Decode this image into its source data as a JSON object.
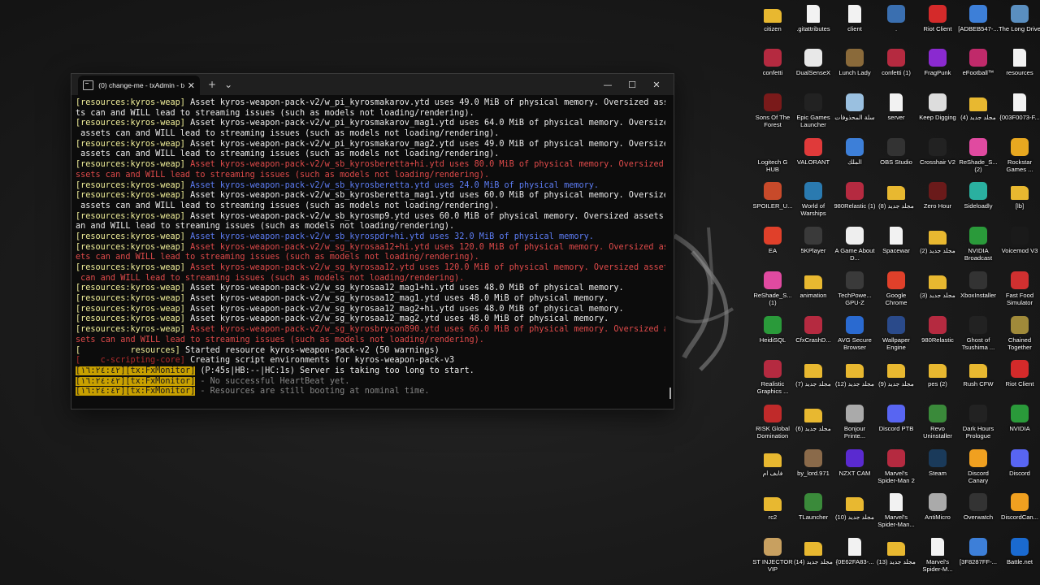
{
  "window": {
    "tab_title": "(0) change-me - txAdmin - txA",
    "tab_close": "✕",
    "new_tab": "+",
    "dropdown": "⌄",
    "minimize": "—",
    "maximize": "☐",
    "close": "✕"
  },
  "console_lines": [
    [
      [
        "c-yellow",
        "[resources:kyros-weap]"
      ],
      [
        "c-white",
        " Asset kyros-weapon-pack-v2/w_pi_kyrosmakarov.ytd uses 49.0 MiB of physical memory. Oversized asse"
      ]
    ],
    [
      [
        "c-white",
        "ts can and WILL lead to streaming issues (such as models not loading/rendering)."
      ]
    ],
    [
      [
        "c-yellow",
        "[resources:kyros-weap]"
      ],
      [
        "c-white",
        " Asset kyros-weapon-pack-v2/w_pi_kyrosmakarov_mag1.ytd uses 64.0 MiB of physical memory. Oversized"
      ]
    ],
    [
      [
        "c-white",
        " assets can and WILL lead to streaming issues (such as models not loading/rendering)."
      ]
    ],
    [
      [
        "c-yellow",
        "[resources:kyros-weap]"
      ],
      [
        "c-white",
        " Asset kyros-weapon-pack-v2/w_pi_kyrosmakarov_mag2.ytd uses 49.0 MiB of physical memory. Oversized"
      ]
    ],
    [
      [
        "c-white",
        " assets can and WILL lead to streaming issues (such as models not loading/rendering)."
      ]
    ],
    [
      [
        "c-yellow",
        "[resources:kyros-weap]"
      ],
      [
        "c-red",
        " Asset kyros-weapon-pack-v2/w_sb_kyrosberetta+hi.ytd uses 80.0 MiB of physical memory. Oversized a"
      ]
    ],
    [
      [
        "c-red",
        "ssets can and WILL lead to streaming issues (such as models not loading/rendering)."
      ]
    ],
    [
      [
        "c-yellow",
        "[resources:kyros-weap]"
      ],
      [
        "c-blue",
        " Asset kyros-weapon-pack-v2/w_sb_kyrosberetta.ytd uses 24.0 MiB of physical memory."
      ]
    ],
    [
      [
        "c-yellow",
        "[resources:kyros-weap]"
      ],
      [
        "c-white",
        " Asset kyros-weapon-pack-v2/w_sb_kyrosberetta_mag1.ytd uses 60.0 MiB of physical memory. Oversized"
      ]
    ],
    [
      [
        "c-white",
        " assets can and WILL lead to streaming issues (such as models not loading/rendering)."
      ]
    ],
    [
      [
        "c-yellow",
        "[resources:kyros-weap]"
      ],
      [
        "c-white",
        " Asset kyros-weapon-pack-v2/w_sb_kyrosmp9.ytd uses 60.0 MiB of physical memory. Oversized assets c"
      ]
    ],
    [
      [
        "c-white",
        "an and WILL lead to streaming issues (such as models not loading/rendering)."
      ]
    ],
    [
      [
        "c-yellow",
        "[resources:kyros-weap]"
      ],
      [
        "c-blue",
        " Asset kyros-weapon-pack-v2/w_sb_kyrospdr+hi.ytd uses 32.0 MiB of physical memory."
      ]
    ],
    [
      [
        "c-yellow",
        "[resources:kyros-weap]"
      ],
      [
        "c-red",
        " Asset kyros-weapon-pack-v2/w_sg_kyrosaa12+hi.ytd uses 120.0 MiB of physical memory. Oversized ass"
      ]
    ],
    [
      [
        "c-red",
        "ets can and WILL lead to streaming issues (such as models not loading/rendering)."
      ]
    ],
    [
      [
        "c-yellow",
        "[resources:kyros-weap]"
      ],
      [
        "c-red",
        " Asset kyros-weapon-pack-v2/w_sg_kyrosaa12.ytd uses 120.0 MiB of physical memory. Oversized assets"
      ]
    ],
    [
      [
        "c-red",
        " can and WILL lead to streaming issues (such as models not loading/rendering)."
      ]
    ],
    [
      [
        "c-yellow",
        "[resources:kyros-weap]"
      ],
      [
        "c-white",
        " Asset kyros-weapon-pack-v2/w_sg_kyrosaa12_mag1+hi.ytd uses 48.0 MiB of physical memory."
      ]
    ],
    [
      [
        "c-yellow",
        "[resources:kyros-weap]"
      ],
      [
        "c-white",
        " Asset kyros-weapon-pack-v2/w_sg_kyrosaa12_mag1.ytd uses 48.0 MiB of physical memory."
      ]
    ],
    [
      [
        "c-yellow",
        "[resources:kyros-weap]"
      ],
      [
        "c-white",
        " Asset kyros-weapon-pack-v2/w_sg_kyrosaa12_mag2+hi.ytd uses 48.0 MiB of physical memory."
      ]
    ],
    [
      [
        "c-yellow",
        "[resources:kyros-weap]"
      ],
      [
        "c-white",
        " Asset kyros-weapon-pack-v2/w_sg_kyrosaa12_mag2.ytd uses 48.0 MiB of physical memory."
      ]
    ],
    [
      [
        "c-yellow",
        "[resources:kyros-weap]"
      ],
      [
        "c-red",
        " Asset kyros-weapon-pack-v2/w_sg_kyrosbryson890.ytd uses 66.0 MiB of physical memory. Oversized as"
      ]
    ],
    [
      [
        "c-red",
        "sets can and WILL lead to streaming issues (such as models not loading/rendering)."
      ]
    ],
    [
      [
        "c-yellow",
        "[          resources]"
      ],
      [
        "c-white",
        " Started resource kyros-weapon-pack-v2 (50 warnings)"
      ]
    ],
    [
      [
        "c-darkred",
        "[    c-scripting-core]"
      ],
      [
        "c-white",
        " Creating script environments for kyros-weapon-pack-v3"
      ]
    ],
    [
      [
        "c-tag",
        "[١٦:٢٤:٤٢][tx:FxMonitor]"
      ],
      [
        "c-white",
        " (P:45s|HB:--|HC:1s) Server is taking too long to start."
      ]
    ],
    [
      [
        "c-tag",
        "[١٦:٢٤:٤٢][tx:FxMonitor]"
      ],
      [
        "c-grey",
        " - No successful HeartBeat yet."
      ]
    ],
    [
      [
        "c-tag",
        "[١٦:٢٤:٤٢][tx:FxMonitor]"
      ],
      [
        "c-grey",
        " - Resources are still booting at nominal time."
      ]
    ]
  ],
  "desktop_icons": [
    {
      "label": "citizen",
      "color": "#e8b830",
      "kind": "folder"
    },
    {
      "label": ".gitattributes",
      "color": "#f2f2f2",
      "kind": "file"
    },
    {
      "label": "client",
      "color": "#f2f2f2",
      "kind": "file"
    },
    {
      "label": ".",
      "color": "#3a6fb0",
      "kind": "app"
    },
    {
      "label": "Riot Client",
      "color": "#d42a2a",
      "kind": "app"
    },
    {
      "label": "[ADBEB547-...",
      "color": "#3d7fd8",
      "kind": "app"
    },
    {
      "label": "The Long Drive",
      "color": "#5a8fc0",
      "kind": "app"
    },
    {
      "label": "confetti",
      "color": "#b52a40",
      "kind": "app"
    },
    {
      "label": "DualSenseX",
      "color": "#e8e8e8",
      "kind": "app"
    },
    {
      "label": "Lunch Lady",
      "color": "#8a6a3a",
      "kind": "app"
    },
    {
      "label": "confetti (1)",
      "color": "#b52a40",
      "kind": "app"
    },
    {
      "label": "FragPunk",
      "color": "#8a2ad0",
      "kind": "app"
    },
    {
      "label": "eFootball™",
      "color": "#c02a6a",
      "kind": "app"
    },
    {
      "label": "resources",
      "color": "#f2f2f2",
      "kind": "file"
    },
    {
      "label": "Sons Of The Forest",
      "color": "#7a1a1a",
      "kind": "app"
    },
    {
      "label": "Epic Games Launcher",
      "color": "#222222",
      "kind": "app"
    },
    {
      "label": "سلة المحذوفات",
      "color": "#9ac0e0",
      "kind": "app"
    },
    {
      "label": "server",
      "color": "#f2f2f2",
      "kind": "file"
    },
    {
      "label": "Keep Digging",
      "color": "#dddddd",
      "kind": "app"
    },
    {
      "label": "مجلد جديد (4)",
      "color": "#e8b830",
      "kind": "folder"
    },
    {
      "label": "{003F0073-F...",
      "color": "#f2f2f2",
      "kind": "file"
    },
    {
      "label": "Logitech G HUB",
      "color": "#1a1a1a",
      "kind": "app"
    },
    {
      "label": "VALORANT",
      "color": "#e03a3a",
      "kind": "app"
    },
    {
      "label": "الملك",
      "color": "#3d7fd8",
      "kind": "app"
    },
    {
      "label": "OBS Studio",
      "color": "#333333",
      "kind": "app"
    },
    {
      "label": "Crosshair V2",
      "color": "#222222",
      "kind": "app"
    },
    {
      "label": "ReShade_S... (2)",
      "color": "#e04aa0",
      "kind": "app"
    },
    {
      "label": "Rockstar Games ...",
      "color": "#e8a820",
      "kind": "app"
    },
    {
      "label": "SPOILER_U...",
      "color": "#c84a2a",
      "kind": "app"
    },
    {
      "label": "World of Warships",
      "color": "#2a7ab0",
      "kind": "app"
    },
    {
      "label": "980Relastic (1)",
      "color": "#b52a40",
      "kind": "app"
    },
    {
      "label": "مجلد جديد (8)",
      "color": "#e8b830",
      "kind": "folder"
    },
    {
      "label": "Zero Hour",
      "color": "#6a1a1a",
      "kind": "app"
    },
    {
      "label": "Sideloadly",
      "color": "#2ab0a0",
      "kind": "app"
    },
    {
      "label": "[lb]",
      "color": "#e8b830",
      "kind": "folder"
    },
    {
      "label": "EA",
      "color": "#e0402a",
      "kind": "app"
    },
    {
      "label": "5KPlayer",
      "color": "#3a3a3a",
      "kind": "app"
    },
    {
      "label": "A Game About D...",
      "color": "#eeeeee",
      "kind": "app"
    },
    {
      "label": "Spacewar",
      "color": "#f2f2f2",
      "kind": "file"
    },
    {
      "label": "مجلد جديد (2)",
      "color": "#e8b830",
      "kind": "folder"
    },
    {
      "label": "NVIDIA Broadcast",
      "color": "#2a9a3a",
      "kind": "app"
    },
    {
      "label": "Voicemod V3",
      "color": "#1a1a1a",
      "kind": "app"
    },
    {
      "label": "ReShade_S... (1)",
      "color": "#e04aa0",
      "kind": "app"
    },
    {
      "label": "animation",
      "color": "#e8b830",
      "kind": "folder"
    },
    {
      "label": "TechPowe... GPU-Z",
      "color": "#3a3a3a",
      "kind": "app"
    },
    {
      "label": "Google Chrome",
      "color": "#e0402a",
      "kind": "app"
    },
    {
      "label": "مجلد جديد (3)",
      "color": "#e8b830",
      "kind": "folder"
    },
    {
      "label": "XboxInstaller",
      "color": "#333333",
      "kind": "app"
    },
    {
      "label": "Fast Food Simulator",
      "color": "#d03030",
      "kind": "app"
    },
    {
      "label": "HeidiSQL",
      "color": "#2a9a3a",
      "kind": "app"
    },
    {
      "label": "CfxCrashD...",
      "color": "#b52a40",
      "kind": "app"
    },
    {
      "label": "AVG Secure Browser",
      "color": "#2a6ad0",
      "kind": "app"
    },
    {
      "label": "Wallpaper Engine",
      "color": "#2a4a8a",
      "kind": "app"
    },
    {
      "label": "980Relastic",
      "color": "#b52a40",
      "kind": "app"
    },
    {
      "label": "Ghost of Tsushima ...",
      "color": "#222222",
      "kind": "app"
    },
    {
      "label": "Chained Together",
      "color": "#a08a3a",
      "kind": "app"
    },
    {
      "label": "Realistic Graphics ...",
      "color": "#b52a40",
      "kind": "app"
    },
    {
      "label": "مجلد جديد (7)",
      "color": "#e8b830",
      "kind": "folder"
    },
    {
      "label": "مجلد جديد (12)",
      "color": "#e8b830",
      "kind": "folder"
    },
    {
      "label": "مجلد جديد (9)",
      "color": "#e8b830",
      "kind": "folder"
    },
    {
      "label": "pes (2)",
      "color": "#e8b830",
      "kind": "folder"
    },
    {
      "label": "Rush CFW",
      "color": "#e8b830",
      "kind": "folder"
    },
    {
      "label": "Riot Client",
      "color": "#d42a2a",
      "kind": "app"
    },
    {
      "label": "RISK Global Domination",
      "color": "#c02a2a",
      "kind": "app"
    },
    {
      "label": "مجلد جديد (6)",
      "color": "#e8b830",
      "kind": "folder"
    },
    {
      "label": "Bonjour Printe...",
      "color": "#aaaaaa",
      "kind": "app"
    },
    {
      "label": "Discord PTB",
      "color": "#5865f2",
      "kind": "app"
    },
    {
      "label": "Revo Uninstaller",
      "color": "#3a8a3a",
      "kind": "app"
    },
    {
      "label": "Dark Hours Prologue",
      "color": "#222222",
      "kind": "app"
    },
    {
      "label": "NVIDIA",
      "color": "#2a9a3a",
      "kind": "app"
    },
    {
      "label": "فايف ام",
      "color": "#e8b830",
      "kind": "folder"
    },
    {
      "label": "by_lord.971",
      "color": "#8a6a4a",
      "kind": "app"
    },
    {
      "label": "NZXT CAM",
      "color": "#5a2ad0",
      "kind": "app"
    },
    {
      "label": "Marvel's Spider-Man 2",
      "color": "#b52a40",
      "kind": "app"
    },
    {
      "label": "Steam",
      "color": "#1a3a5a",
      "kind": "app"
    },
    {
      "label": "Discord Canary",
      "color": "#f0a020",
      "kind": "app"
    },
    {
      "label": "Discord",
      "color": "#5865f2",
      "kind": "app"
    },
    {
      "label": "rc2",
      "color": "#e8b830",
      "kind": "folder"
    },
    {
      "label": "TLauncher",
      "color": "#3a8a3a",
      "kind": "app"
    },
    {
      "label": "مجلد جديد (10)",
      "color": "#e8b830",
      "kind": "folder"
    },
    {
      "label": "Marvel's Spider-Man...",
      "color": "#f2f2f2",
      "kind": "file"
    },
    {
      "label": "AntiMicro",
      "color": "#aaaaaa",
      "kind": "app"
    },
    {
      "label": "Overwatch",
      "color": "#333333",
      "kind": "app"
    },
    {
      "label": "DiscordCan...",
      "color": "#f0a020",
      "kind": "app"
    },
    {
      "label": "ST INJECTOR VIP",
      "color": "#c8a060",
      "kind": "app"
    },
    {
      "label": "مجلد جديد (14)",
      "color": "#e8b830",
      "kind": "folder"
    },
    {
      "label": "{0E62FA83-...",
      "color": "#f2f2f2",
      "kind": "file"
    },
    {
      "label": "مجلد جديد (13)",
      "color": "#e8b830",
      "kind": "folder"
    },
    {
      "label": "Marvel's Spider-M...",
      "color": "#f2f2f2",
      "kind": "file"
    },
    {
      "label": "[3F8287FF-...",
      "color": "#3d7fd8",
      "kind": "app"
    },
    {
      "label": "Battle.net",
      "color": "#1a6ad0",
      "kind": "app"
    }
  ]
}
